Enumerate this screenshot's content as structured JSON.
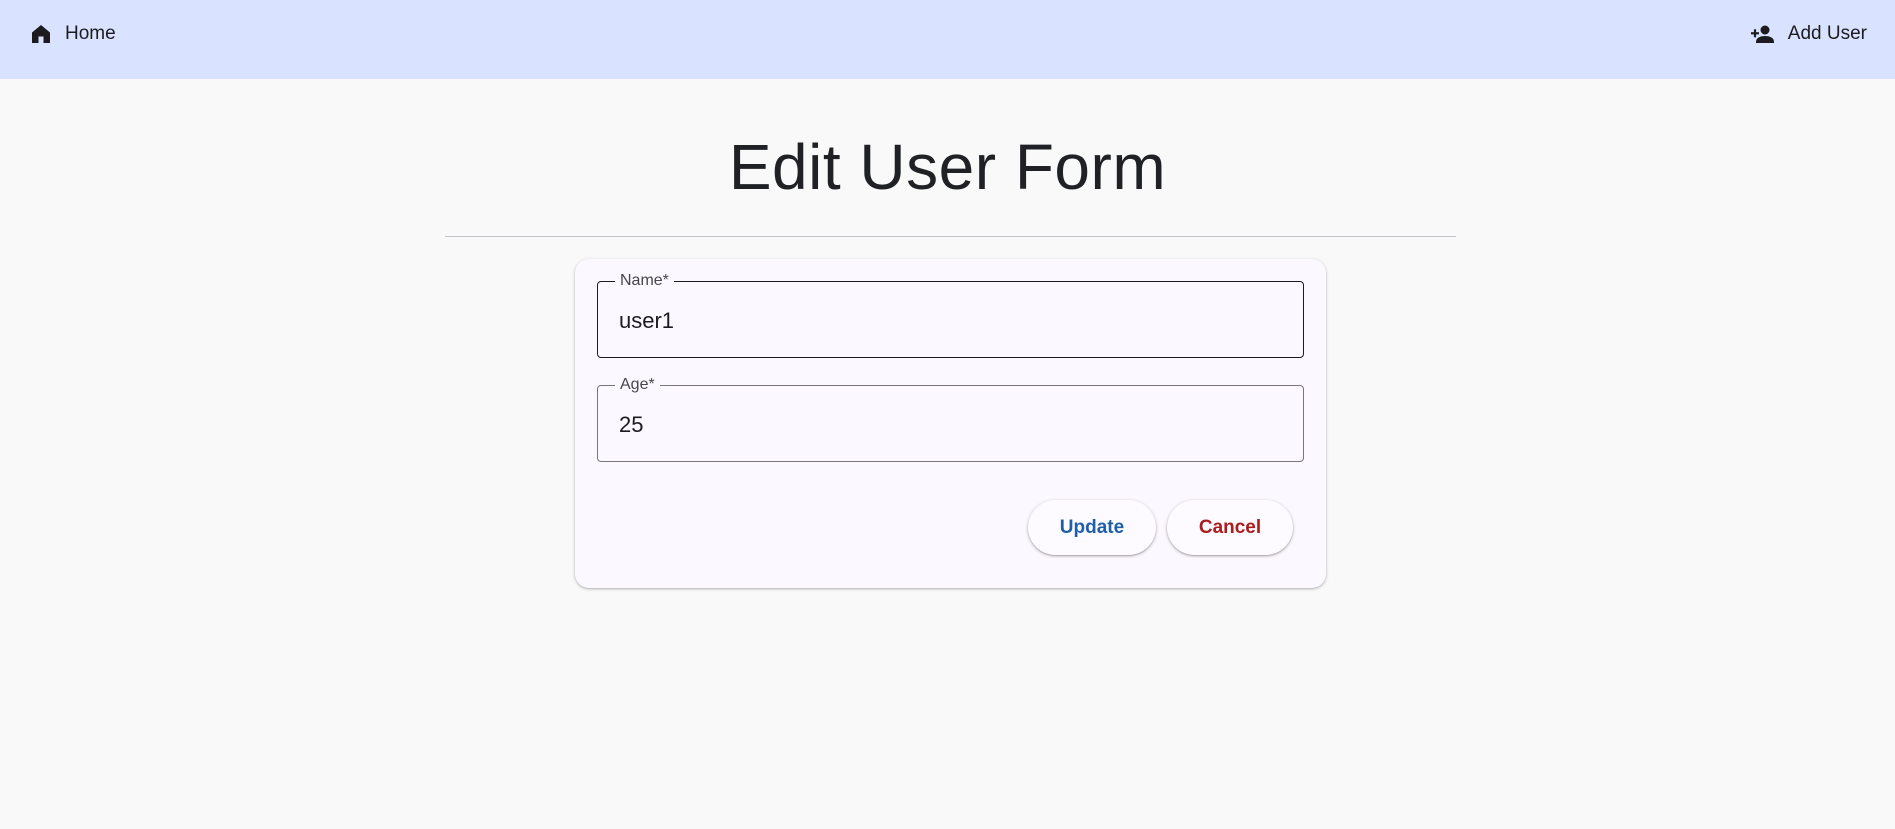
{
  "nav": {
    "home_label": "Home",
    "home_icon": "home-icon",
    "add_user_label": "Add User",
    "add_user_icon": "person-add-icon"
  },
  "page": {
    "title": "Edit User Form"
  },
  "form": {
    "name": {
      "label": "Name*",
      "value": "user1"
    },
    "age": {
      "label": "Age*",
      "value": "25"
    },
    "update_label": "Update",
    "cancel_label": "Cancel"
  },
  "colors": {
    "topbar_bg": "#d9e3ff",
    "update_text": "#1d5fa8",
    "cancel_text": "#ac1c1c"
  }
}
